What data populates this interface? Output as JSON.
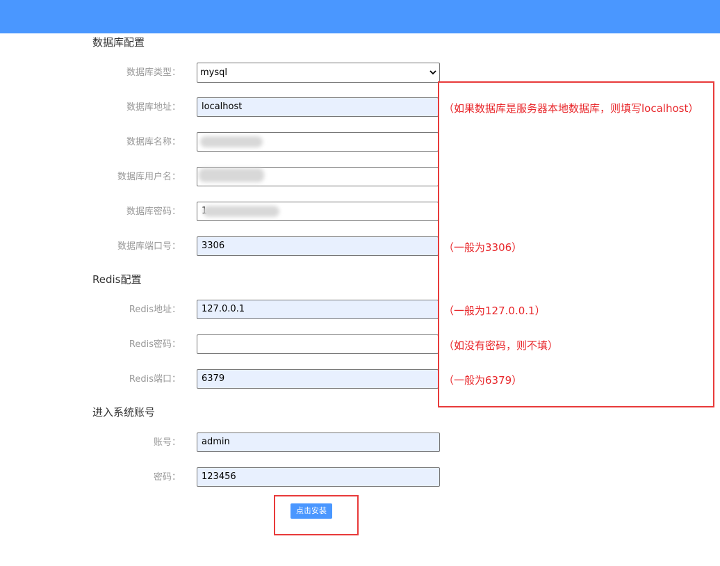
{
  "sections": {
    "database": "数据库配置",
    "redis": "Redis配置",
    "account": "进入系统账号"
  },
  "labels": {
    "db_type": "数据库类型：",
    "db_host": "数据库地址：",
    "db_name": "数据库名称：",
    "db_user": "数据库用户名：",
    "db_password": "数据库密码：",
    "db_port": "数据库端口号：",
    "redis_host": "Redis地址：",
    "redis_password": "Redis密码：",
    "redis_port": "Redis端口：",
    "account_user": "账号：",
    "account_password": "密码："
  },
  "values": {
    "db_type": "mysql",
    "db_host": "localhost",
    "db_name": "",
    "db_user": "",
    "db_password": "1",
    "db_port": "3306",
    "redis_host": "127.0.0.1",
    "redis_password": "",
    "redis_port": "6379",
    "account_user": "admin",
    "account_password": "123456"
  },
  "notes": {
    "db_host": "（如果数据库是服务器本地数据库，则填写localhost）",
    "db_port": "（一般为3306）",
    "redis_host": "（一般为127.0.0.1）",
    "redis_password": "（如没有密码，则不填）",
    "redis_port": "（一般为6379）"
  },
  "install_button": "点击安装",
  "colors": {
    "header": "#4a97ff",
    "button": "#4a97ff",
    "annotation": "#e8262a",
    "autofill_bg": "#e8f0fe"
  },
  "icons": {
    "select_arrow": "chevron-down-icon"
  }
}
